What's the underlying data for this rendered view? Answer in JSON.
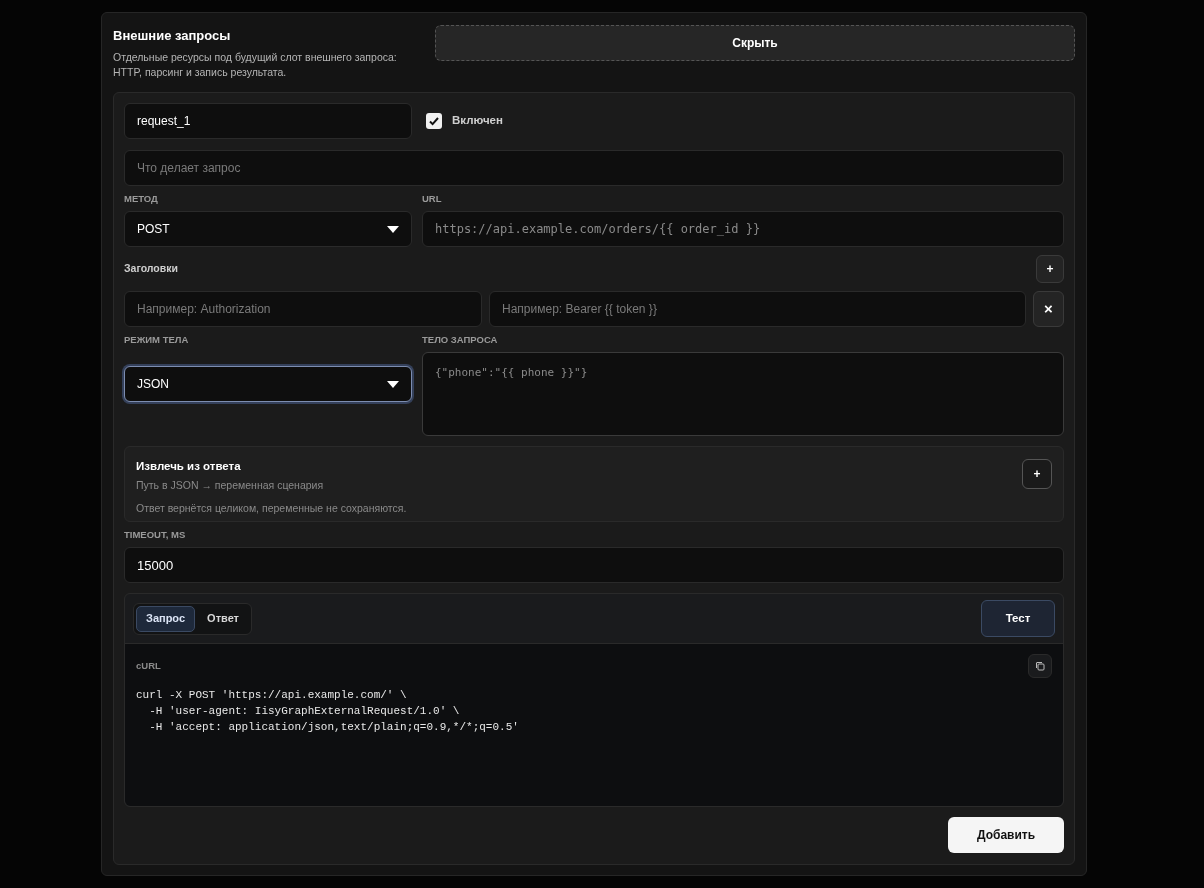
{
  "section": {
    "title": "Внешние запросы",
    "description": "Отдельные ресурсы под будущий слот внешнего запроса: HTTP, парсинг и запись результата.",
    "toggle_button": "Скрыть"
  },
  "request": {
    "name": {
      "value": "request_1"
    },
    "enabled": {
      "label": "Включен",
      "checked": true
    },
    "description": {
      "placeholder": "Что делает запрос"
    },
    "method": {
      "label": "МЕТОД",
      "value": "POST",
      "focused": false
    },
    "url": {
      "label": "URL",
      "placeholder": "https://api.example.com/orders/{{ order_id }}"
    },
    "headers": {
      "label": "Заголовки",
      "add_button": "+",
      "rows": [
        {
          "name_placeholder": "Например: Authorization",
          "value_placeholder": "Например: Bearer {{ token }}",
          "remove_button": "×"
        }
      ]
    },
    "body_mode": {
      "label": "РЕЖИМ ТЕЛА",
      "value": "JSON",
      "focused": true
    },
    "body": {
      "label": "ТЕЛО ЗАПРОСА",
      "placeholder": "{\"phone\":\"{{ phone }}\"}"
    },
    "extract": {
      "title": "Извлечь из ответа",
      "subtitle": "Путь в JSON → переменная сценария",
      "note": "Ответ вернётся целиком, переменные не сохраняются.",
      "add_button": "+"
    },
    "timeout": {
      "label": "TIMEOUT, MS",
      "value": "15000"
    },
    "preview": {
      "tabs": [
        {
          "label": "Запрос",
          "selected": true
        },
        {
          "label": "Ответ",
          "selected": false
        }
      ],
      "test_button": "Тест",
      "code_label": "cURL",
      "code": "curl -X POST 'https://api.example.com/' \\\n  -H 'user-agent: IisyGraphExternalRequest/1.0' \\\n  -H 'accept: application/json,text/plain;q=0.9,*/*;q=0.5'"
    },
    "submit_button": "Добавить"
  }
}
